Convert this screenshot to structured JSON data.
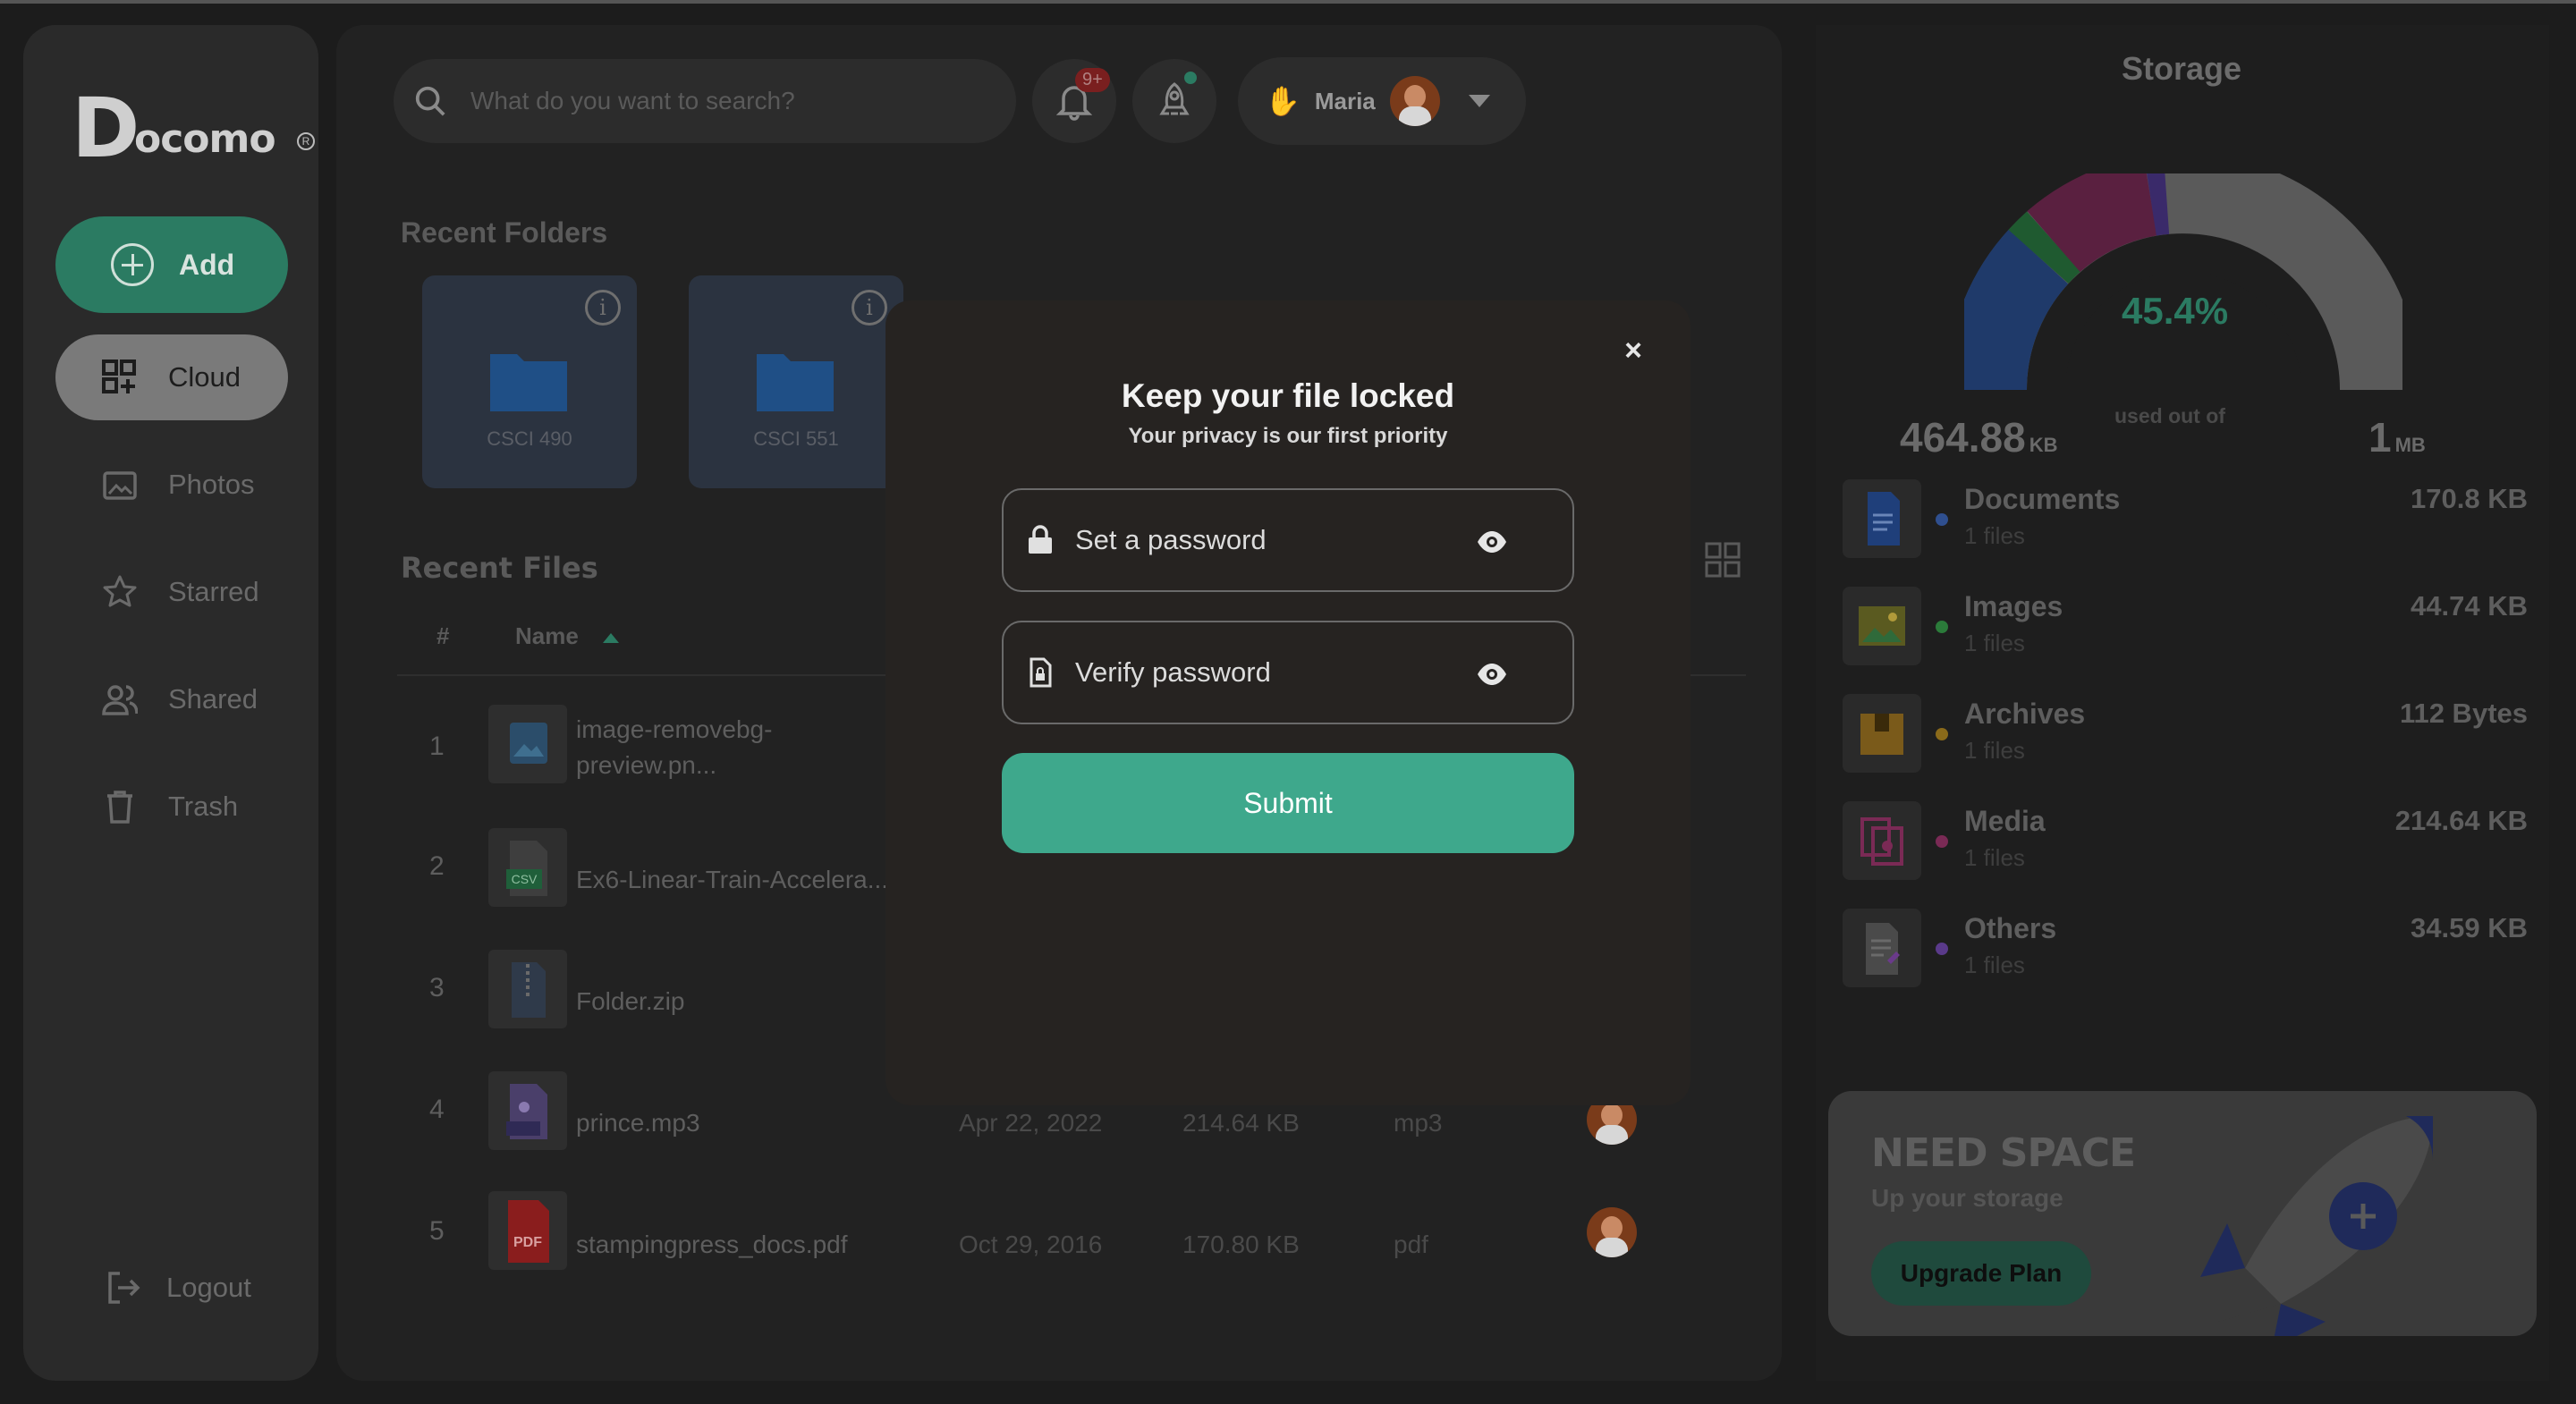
{
  "app": {
    "logo_initial": "D",
    "logo_rest": "ocomo",
    "logo_mark": "R"
  },
  "sidebar": {
    "add_label": "Add",
    "items": [
      {
        "label": "Cloud",
        "icon": "cloud-grid-icon",
        "active": true
      },
      {
        "label": "Photos",
        "icon": "photos-icon"
      },
      {
        "label": "Starred",
        "icon": "star-icon"
      },
      {
        "label": "Shared",
        "icon": "shared-users-icon"
      },
      {
        "label": "Trash",
        "icon": "trash-icon"
      }
    ],
    "logout_label": "Logout"
  },
  "header": {
    "search_placeholder": "What do you want to search?",
    "notification_badge": "9+",
    "user_name": "Maria"
  },
  "recent_folders": {
    "title": "Recent Folders",
    "folders": [
      {
        "name": "CSCI 490"
      },
      {
        "name": "CSCI 551"
      }
    ]
  },
  "recent_files": {
    "title": "Recent Files",
    "columns": {
      "index": "#",
      "name": "Name"
    },
    "rows": [
      {
        "num": "1",
        "name_line1": "image-removebg-",
        "name_line2": "preview.pn...",
        "date": "",
        "size": "",
        "type": ""
      },
      {
        "num": "2",
        "name_line1": "Ex6-Linear-Train-Accelera...",
        "name_line2": "",
        "date": "",
        "size": "",
        "type": ""
      },
      {
        "num": "3",
        "name_line1": "Folder.zip",
        "name_line2": "",
        "date": "",
        "size": "",
        "type": ""
      },
      {
        "num": "4",
        "name_line1": "prince.mp3",
        "name_line2": "",
        "date": "Apr 22, 2022",
        "size": "214.64 KB",
        "type": "mp3"
      },
      {
        "num": "5",
        "name_line1": "stampingpress_docs.pdf",
        "name_line2": "",
        "date": "Oct 29, 2016",
        "size": "170.80 KB",
        "type": "pdf"
      }
    ]
  },
  "storage": {
    "title": "Storage",
    "used_percent": "45.4%",
    "used_value": "464.88",
    "used_unit": "KB",
    "used_label": "used out of",
    "total_value": "1",
    "total_unit": "MB",
    "categories": [
      {
        "name": "Documents",
        "count": "1 files",
        "size": "170.8 KB",
        "color": "#2f4f8f"
      },
      {
        "name": "Images",
        "count": "1 files",
        "size": "44.74 KB",
        "color": "#2b7b3a"
      },
      {
        "name": "Archives",
        "count": "1 files",
        "size": "112 Bytes",
        "color": "#8a6a1a"
      },
      {
        "name": "Media",
        "count": "1 files",
        "size": "214.64 KB",
        "color": "#7a2a55"
      },
      {
        "name": "Others",
        "count": "1 files",
        "size": "34.59 KB",
        "color": "#5a3a8a"
      }
    ]
  },
  "promo": {
    "heading": "NEED SPACE",
    "subheading": "Up your storage",
    "button": "Upgrade Plan"
  },
  "modal": {
    "close_symbol": "×",
    "title": "Keep your file locked",
    "subtitle": "Your privacy is our first priority",
    "password_placeholder": "Set a password",
    "verify_placeholder": "Verify password",
    "submit_label": "Submit"
  },
  "colors": {
    "accent": "#3ea88c",
    "overlay_bg": "#1c1c1c"
  }
}
